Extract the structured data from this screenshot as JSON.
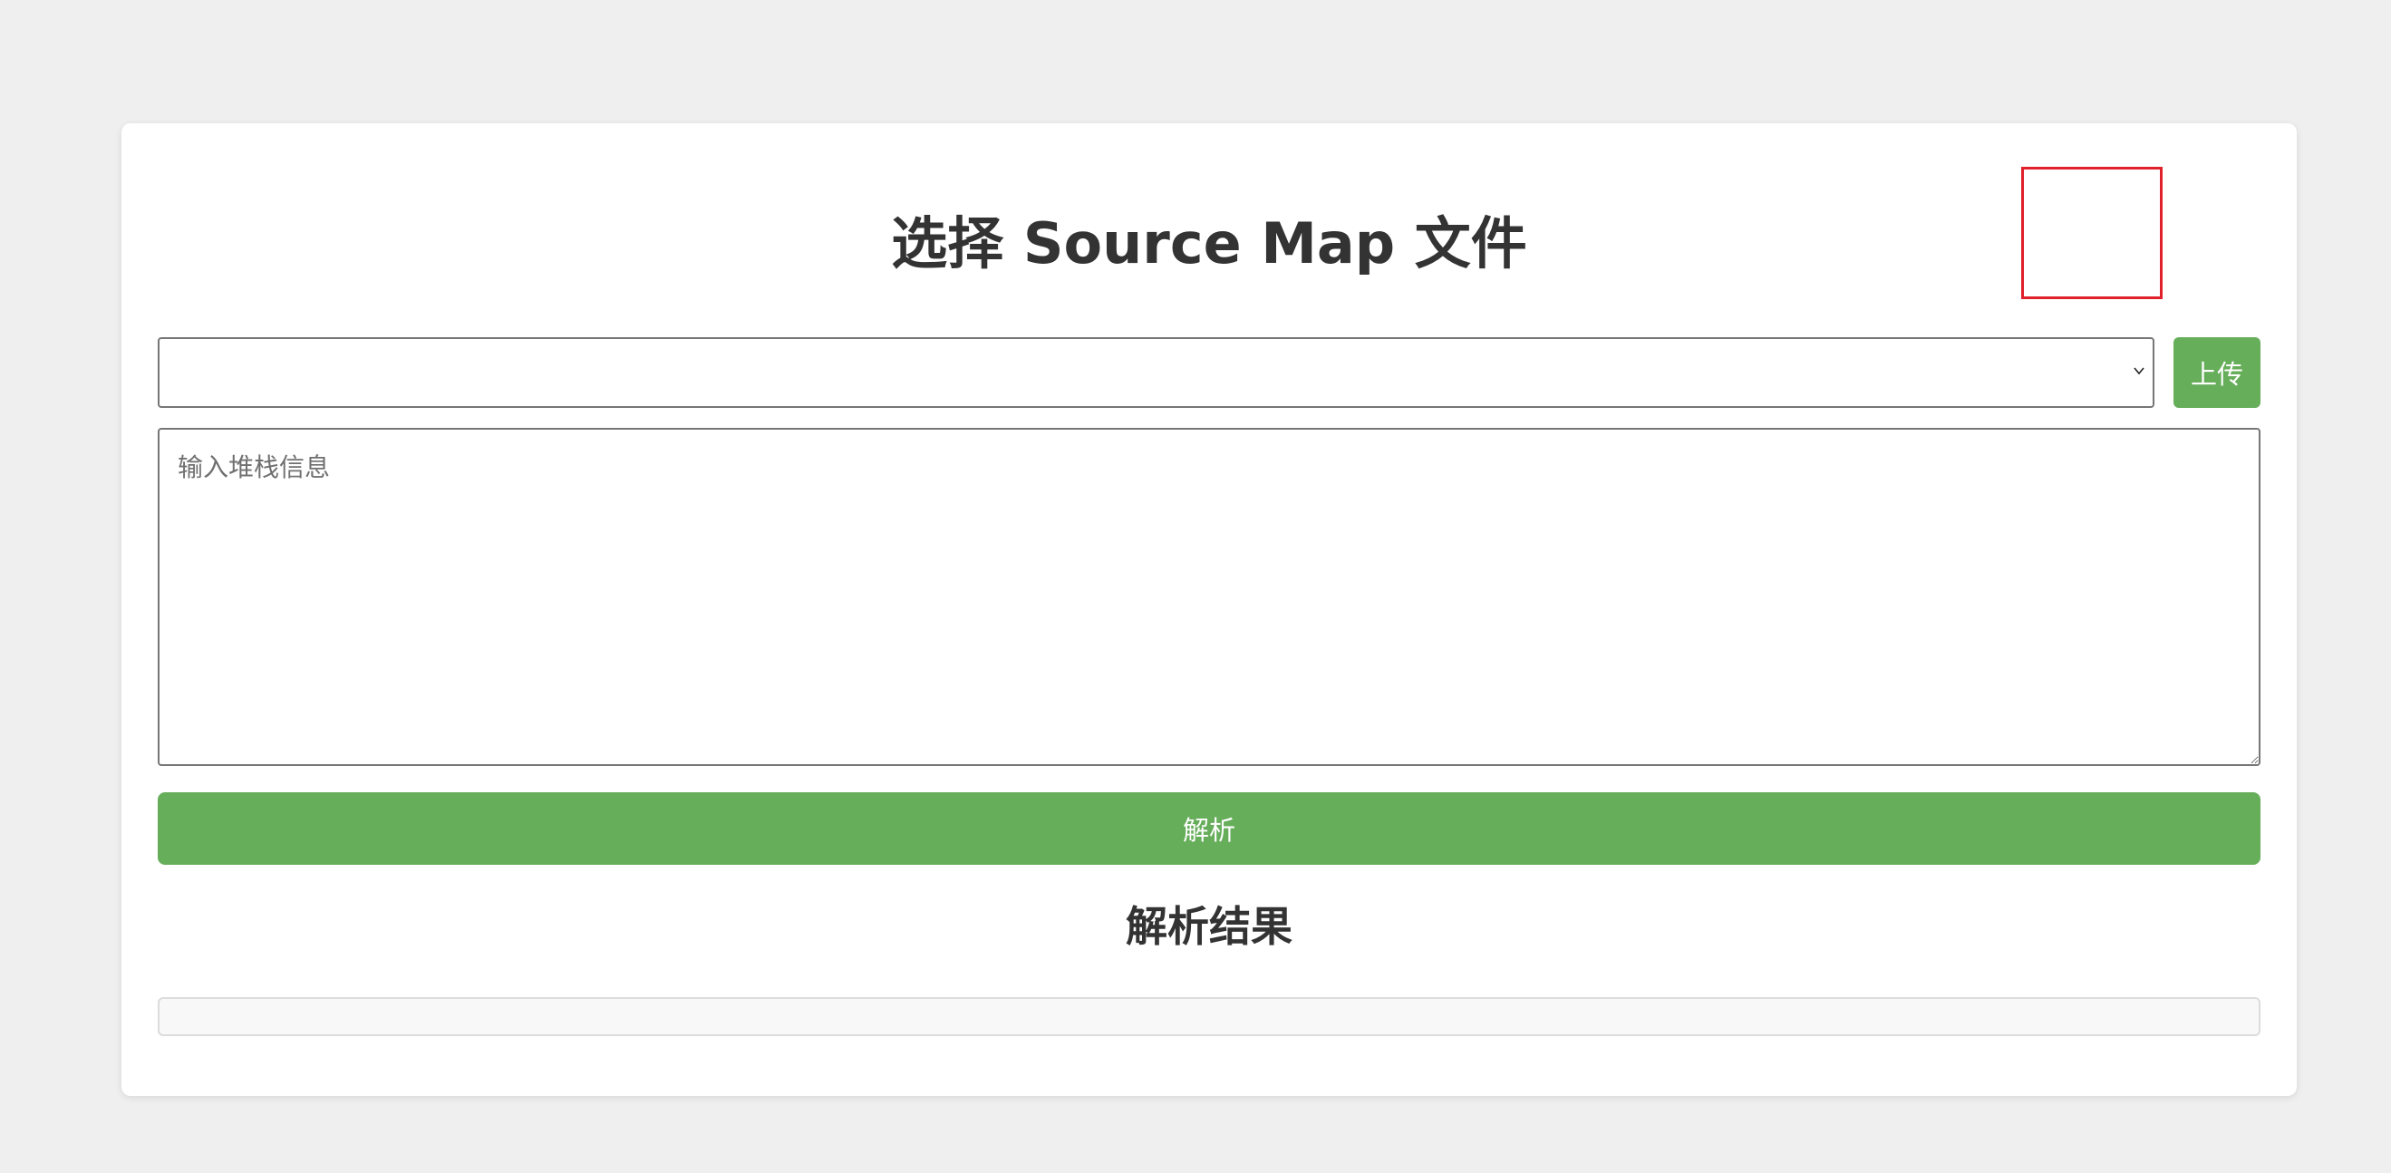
{
  "page": {
    "title": "选择 Source Map 文件"
  },
  "source_map_select": {
    "selected_value": "",
    "icon": "chevron-down-icon"
  },
  "upload_button": {
    "label": "上传",
    "color": "#67ae5b"
  },
  "stack_input": {
    "value": "",
    "placeholder": "输入堆栈信息"
  },
  "parse_button": {
    "label": "解析",
    "color": "#67ae5b"
  },
  "result": {
    "title": "解析结果",
    "content": ""
  },
  "highlight": {
    "target": "upload_button",
    "color": "#e0212b"
  }
}
